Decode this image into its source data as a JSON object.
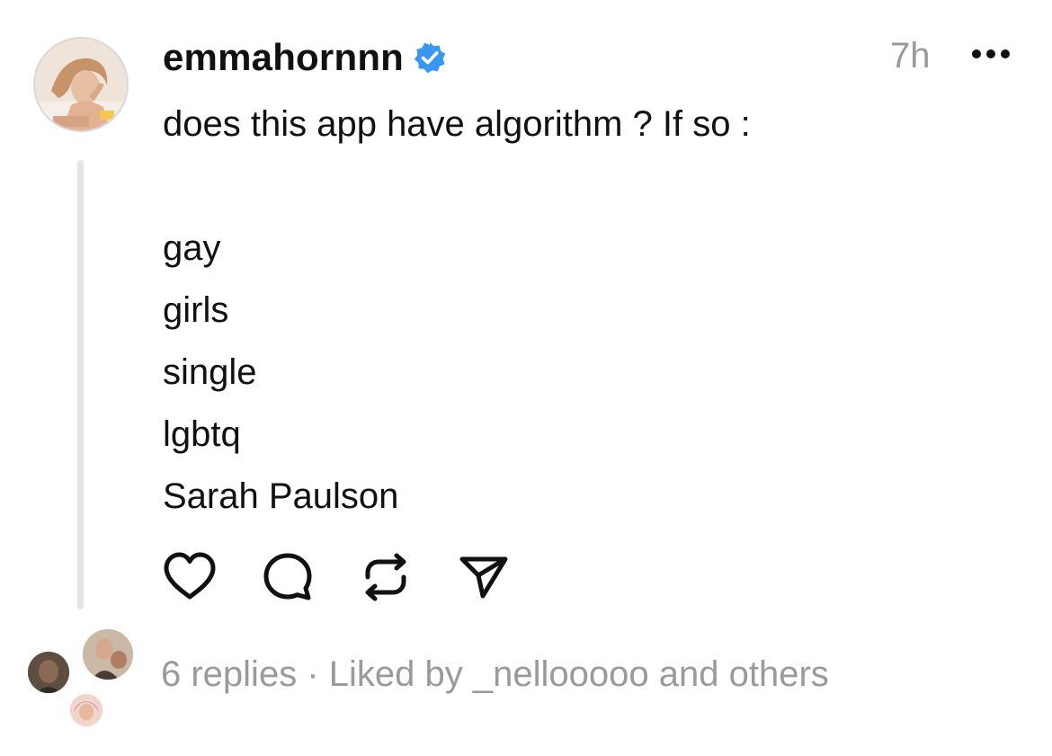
{
  "post": {
    "username": "emmahornnn",
    "verified": true,
    "timestamp": "7h",
    "more_icon": "more-horizontal-icon",
    "text_lines": [
      "does this app have algorithm ? If so :",
      "",
      "gay",
      "girls",
      "single",
      "lgbtq",
      "Sarah Paulson"
    ],
    "actions": [
      {
        "name": "like",
        "icon": "heart-icon"
      },
      {
        "name": "reply",
        "icon": "comment-bubble-icon"
      },
      {
        "name": "repost",
        "icon": "repost-icon"
      },
      {
        "name": "share",
        "icon": "send-icon"
      }
    ]
  },
  "footer": {
    "replies": "6 replies",
    "separator": "·",
    "liked_by": "Liked by _nellooooo and others"
  },
  "colors": {
    "verified_badge": "#3897f0",
    "text_primary": "#111111",
    "text_secondary": "#9a9a9a",
    "thread_line": "#e4e4e4"
  }
}
